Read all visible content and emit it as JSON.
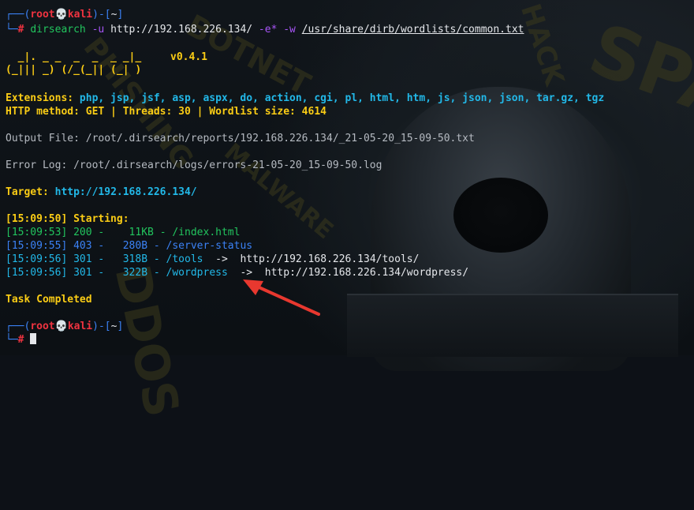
{
  "prompt": {
    "corner_top": "┌──(",
    "user": "root",
    "skull": "💀",
    "host": "kali",
    "mid": ")-[",
    "dir": "~",
    "end": "]",
    "corner_bottom": "└─",
    "hash": "#"
  },
  "command": {
    "program": "dirsearch",
    "flag_u": "-u",
    "url": "http://192.168.226.134/",
    "flag_e": "-e*",
    "flag_w": "-w",
    "wordlist": "/usr/share/dirb/wordlists/common.txt"
  },
  "banner": {
    "art_line1": "  _|. _ _  _  _  _ _|_    ",
    "art_line2": "(_||| _) (/_(_|| (_| )",
    "version": "v0.4.1"
  },
  "info": {
    "extensions_label": "Extensions:",
    "extensions_value": "php, jsp, jsf, asp, aspx, do, action, cgi, pl, html, htm, js, json, json, tar.gz, tgz",
    "method_line": "HTTP method: GET | Threads: 30 | Wordlist size: 4614",
    "output_file": "Output File: /root/.dirsearch/reports/192.168.226.134/_21-05-20_15-09-50.txt",
    "error_log": "Error Log: /root/.dirsearch/logs/errors-21-05-20_15-09-50.log",
    "target_label": "Target:",
    "target_value": "http://192.168.226.134/"
  },
  "results": {
    "starting": "[15:09:50] Starting:",
    "rows": [
      {
        "time": "[15:09:53]",
        "status": "200",
        "size": "   11KB",
        "path": "/index.html",
        "redirect": ""
      },
      {
        "time": "[15:09:55]",
        "status": "403",
        "size": "  280B",
        "path": "/server-status",
        "redirect": ""
      },
      {
        "time": "[15:09:56]",
        "status": "301",
        "size": "  318B",
        "path": "/tools",
        "redirect": "->  http://192.168.226.134/tools/"
      },
      {
        "time": "[15:09:56]",
        "status": "301",
        "size": "  322B",
        "path": "/wordpress",
        "redirect": "->  http://192.168.226.134/wordpress/"
      }
    ],
    "completed": "Task Completed"
  },
  "watermarks": [
    "BOTNET",
    "PHISHING",
    "MALWARE",
    "DDOS",
    "SPAM",
    "HACK"
  ],
  "colors": {
    "prompt_frame": "#3b82f6",
    "prompt_user": "#ef3340",
    "command": "#22c55e",
    "banner": "#facc15",
    "info": "#22b8e8",
    "annotation_arrow": "#e8382f"
  }
}
